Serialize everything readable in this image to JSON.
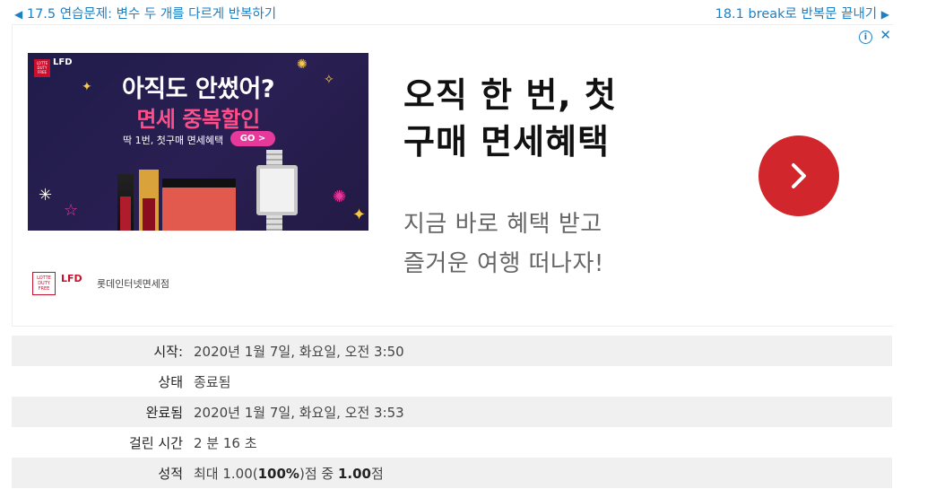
{
  "nav": {
    "prev": {
      "arrow": "◀",
      "label": "17.5 연습문제: 변수 두 개를 다르게 반복하기"
    },
    "next": {
      "label": "18.1 break로 반복문 끝내기",
      "arrow": "▶"
    }
  },
  "ad": {
    "info_icon": "i",
    "close_icon": "✕",
    "banner": {
      "logo_text": "LOTTE DUTY FREE",
      "logo_mark": "LFD",
      "title": "아직도 안썼어?",
      "subtitle": "면세 중복할인",
      "small": "딱 1번, 첫구매 면세혜택",
      "go": "GO >"
    },
    "advertiser": {
      "logo_text": "LOTTE DUTY FREE",
      "logo_mark": "LFD",
      "name": "롯데인터넷면세점"
    },
    "headline": [
      "오직 한 번, 첫",
      "구매 면세혜택"
    ],
    "description": [
      "지금 바로 혜택 받고",
      "즐거운 여행 떠나자!"
    ],
    "cta_icon": "chevron-right-icon",
    "colors": {
      "cta": "#d1262c",
      "banner_bg": "#1f1c4a",
      "pink": "#ff4d8a",
      "link": "#1d7fc4"
    }
  },
  "summary": {
    "rows": [
      {
        "label": "시작:",
        "value": "2020년 1월 7일, 화요일, 오전 3:50"
      },
      {
        "label": "상태",
        "value": "종료됨"
      },
      {
        "label": "완료됨",
        "value": "2020년 1월 7일, 화요일, 오전 3:53"
      },
      {
        "label": "걸린 시간",
        "value": "2 분 16 초"
      },
      {
        "label": "성적",
        "value_prefix": "최대 1.00(",
        "value_percent": "100%",
        "value_mid": ")점 중 ",
        "value_score": "1.00",
        "value_suffix": "점"
      }
    ]
  }
}
